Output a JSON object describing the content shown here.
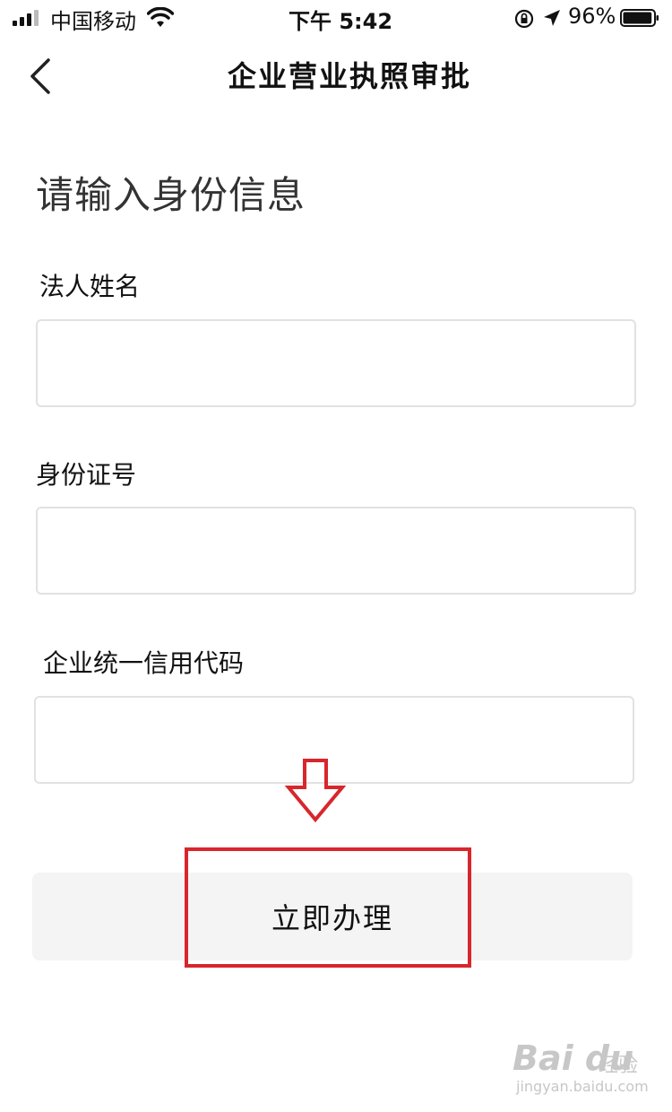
{
  "status_bar": {
    "carrier": "中国移动",
    "time": "下午 5:42",
    "battery_percent": "96%",
    "battery_level": 0.96
  },
  "nav": {
    "title": "企业营业执照审批",
    "back_icon": "chevron-left-icon"
  },
  "form": {
    "heading": "请输入身份信息",
    "fields": [
      {
        "label": "法人姓名",
        "value": "",
        "placeholder": ""
      },
      {
        "label": "身份证号",
        "value": "",
        "placeholder": ""
      },
      {
        "label": "企业统一信用代码",
        "value": "",
        "placeholder": ""
      }
    ],
    "submit_label": "立即办理"
  },
  "annotation": {
    "arrow_icon": "down-arrow-icon",
    "highlight_color": "#d8262c"
  },
  "watermark": {
    "logo": "Bai du",
    "brand": "经验",
    "url": "jingyan.baidu.com"
  }
}
